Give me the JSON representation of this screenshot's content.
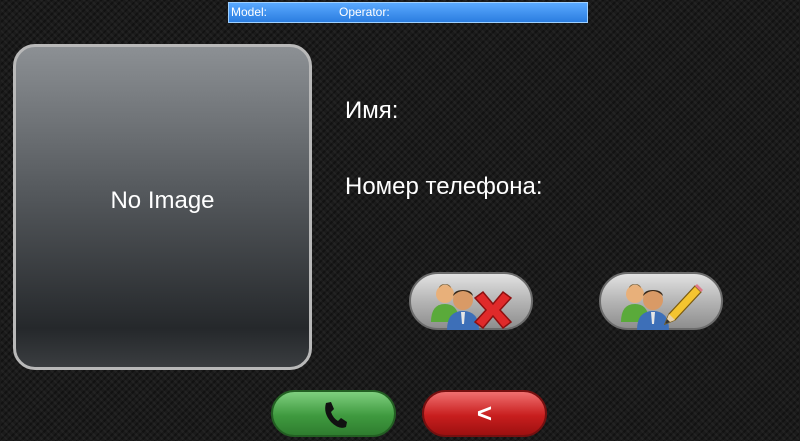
{
  "status_bar": {
    "model_label": "Model:",
    "operator_label": "Operator:"
  },
  "contact": {
    "photo_placeholder": "No Image",
    "name_label": "Имя:",
    "phone_label": "Номер телефона:"
  },
  "actions": {
    "delete_icon": "delete-contact-icon",
    "edit_icon": "edit-contact-icon"
  },
  "bottom": {
    "call_icon": "phone-icon",
    "back_label": "<"
  }
}
